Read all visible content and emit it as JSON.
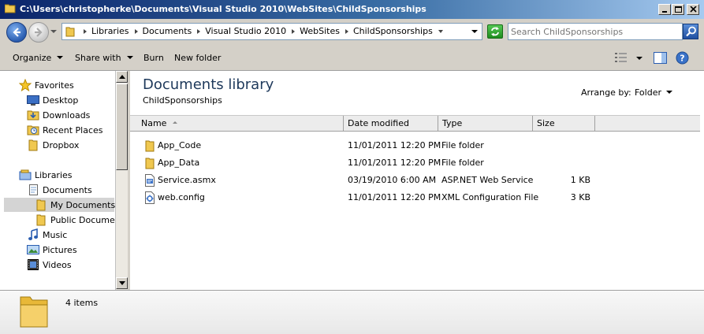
{
  "window": {
    "title": "C:\\Users\\christopherke\\Documents\\Visual Studio 2010\\WebSites\\ChildSponsorships"
  },
  "address": {
    "breadcrumbs": [
      "Libraries",
      "Documents",
      "Visual Studio 2010",
      "WebSites",
      "ChildSponsorships"
    ]
  },
  "search": {
    "placeholder": "Search ChildSponsorships"
  },
  "toolbar": {
    "organize": "Organize",
    "share_with": "Share with",
    "burn": "Burn",
    "new_folder": "New folder"
  },
  "nav": {
    "favorites": "Favorites",
    "desktop": "Desktop",
    "downloads": "Downloads",
    "recent_places": "Recent Places",
    "dropbox": "Dropbox",
    "libraries": "Libraries",
    "documents": "Documents",
    "my_documents": "My Documents",
    "public_documents": "Public Documents",
    "music": "Music",
    "pictures": "Pictures",
    "videos": "Videos"
  },
  "content": {
    "library_title": "Documents library",
    "library_subtitle": "ChildSponsorships",
    "arrange_by_label": "Arrange by:",
    "arrange_by_value": "Folder",
    "columns": {
      "name": "Name",
      "date_modified": "Date modified",
      "type": "Type",
      "size": "Size"
    },
    "files": [
      {
        "name": "App_Code",
        "date": "11/01/2011 12:20 PM",
        "type": "File folder",
        "size": "",
        "icon": "folder-icon"
      },
      {
        "name": "App_Data",
        "date": "11/01/2011 12:20 PM",
        "type": "File folder",
        "size": "",
        "icon": "folder-icon"
      },
      {
        "name": "Service.asmx",
        "date": "03/19/2010 6:00 AM",
        "type": "ASP.NET Web Service",
        "size": "1 KB",
        "icon": "asmx-file-icon"
      },
      {
        "name": "web.config",
        "date": "11/01/2011 12:20 PM",
        "type": "XML Configuration File",
        "size": "3 KB",
        "icon": "config-file-icon"
      }
    ]
  },
  "details": {
    "item_count": "4 items"
  },
  "colors": {
    "title_bar_start": "#0a246a",
    "title_bar_end": "#a6caf0",
    "chrome": "#d4d0c8",
    "folder_yellow": "#f0c850",
    "library_title": "#1e395b",
    "selected_nav": "#d4d4d4"
  }
}
